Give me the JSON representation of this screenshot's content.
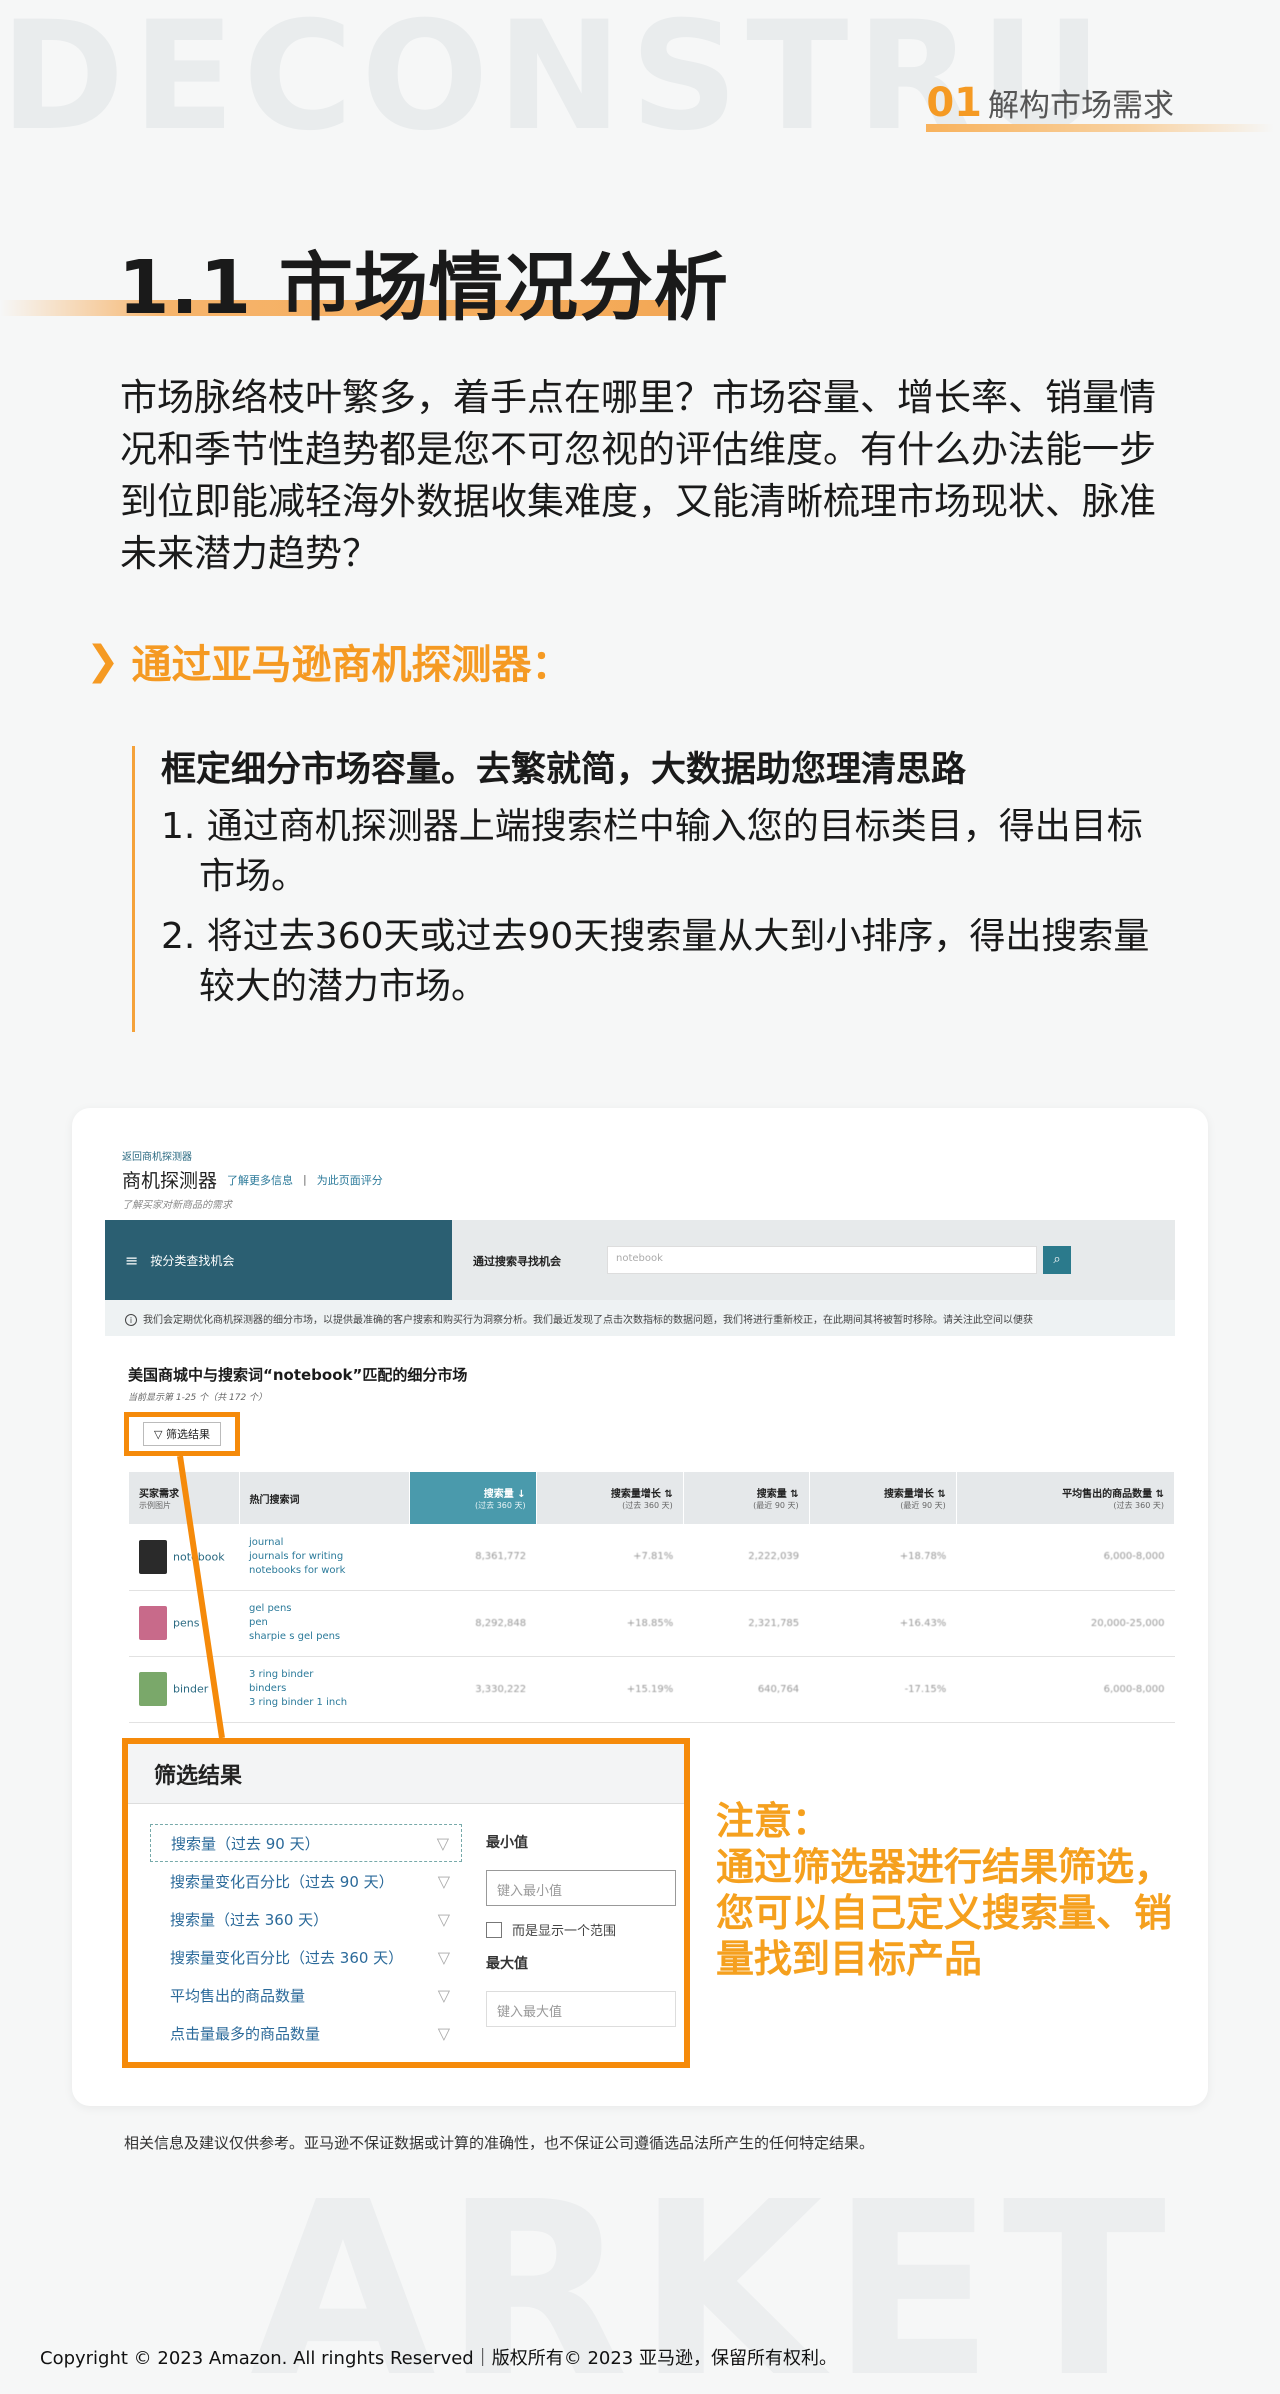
{
  "background": {
    "top_word": "DECONSTRU",
    "bottom_word": "ARKET"
  },
  "section_tag": {
    "number": "01",
    "label": "解构市场需求"
  },
  "heading": "1.1 市场情况分析",
  "intro": "市场脉络枝叶繁多，着手点在哪里？市场容量、增长率、销量情况和季节性趋势都是您不可忽视的评估维度。有什么办法能一步到位即能减轻海外数据收集难度，又能清晰梳理市场现状、脉准未来潜力趋势？",
  "subheading": "通过亚马逊商机探测器：",
  "quote": {
    "title": "框定细分市场容量。去繁就简，大数据助您理清思路",
    "items": [
      "1. 通过商机探测器上端搜索栏中输入您的目标类目，得出目标市场。",
      "2. 将过去360天或过去90天搜索量从大到小排序，得出搜索量较大的潜力市场。"
    ]
  },
  "screenshot": {
    "breadcrumb": "返回商机探测器",
    "title": "商机探测器",
    "learn_more": "了解更多信息",
    "separator": "|",
    "rate": "为此页面评分",
    "desc": "了解买家对新商品的需求",
    "nav_label": "按分类查找机会",
    "search_label": "通过搜索寻找机会",
    "search_value": "notebook",
    "notice": "我们会定期优化商机探测器的细分市场，以提供最准确的客户搜索和购买行为洞察分析。我们最近发现了点击次数指标的数据问题，我们将进行重新校正，在此期间其将被暂时移除。请关注此空间以便获",
    "results_title": "美国商城中与搜索词“notebook”匹配的细分市场",
    "results_count": "当前显示第 1-25 个（共 172 个）",
    "filter_button": "筛选结果",
    "columns": [
      {
        "name": "买家需求",
        "sub": "示例图片"
      },
      {
        "name": "热门搜索词",
        "sub": ""
      },
      {
        "name": "搜索量",
        "sub": "(过去 360 天)"
      },
      {
        "name": "搜索量增长",
        "sub": "(过去 360 天)"
      },
      {
        "name": "搜索量",
        "sub": "(最近 90 天)"
      },
      {
        "name": "搜索量增长",
        "sub": "(最近 90 天)"
      },
      {
        "name": "平均售出的商品数量",
        "sub": "(过去 360 天)"
      }
    ],
    "rows": [
      {
        "niche": "notebook",
        "keywords": [
          "journal",
          "journals for writing",
          "notebooks for work"
        ],
        "v1": "8,361,772",
        "v2": "+7.81%",
        "v3": "2,222,039",
        "v4": "+18.78%",
        "v5": "6,000-8,000",
        "color": "#2a2a2a"
      },
      {
        "niche": "pens",
        "keywords": [
          "gel pens",
          "pen",
          "sharpie s gel pens"
        ],
        "v1": "8,292,848",
        "v2": "+18.85%",
        "v3": "2,321,785",
        "v4": "+16.43%",
        "v5": "20,000-25,000",
        "color": "#c86a8a"
      },
      {
        "niche": "binder",
        "keywords": [
          "3 ring binder",
          "binders",
          "3 ring binder 1 inch"
        ],
        "v1": "3,330,222",
        "v2": "+15.19%",
        "v3": "640,764",
        "v4": "-17.15%",
        "v5": "6,000-8,000",
        "color": "#7aa86a"
      }
    ],
    "filter_panel": {
      "title": "筛选结果",
      "items": [
        "搜索量（过去 90 天）",
        "搜索量变化百分比（过去 90 天）",
        "搜索量（过去 360 天）",
        "搜索量变化百分比（过去 360 天）",
        "平均售出的商品数量",
        "点击量最多的商品数量"
      ],
      "min_label": "最小值",
      "min_placeholder": "键入最小值",
      "range_check": "而是显示一个范围",
      "max_label": "最大值",
      "max_placeholder": "键入最大值"
    }
  },
  "note": {
    "title": "注意：",
    "body": "通过筛选器进行结果筛选，您可以自己定义搜索量、销量找到目标产品"
  },
  "disclaimer": "相关信息及建议仅供参考。亚马逊不保证数据或计算的准确性，也不保证公司遵循选品法所产生的任何特定结果。",
  "copyright": "Copyright © 2023 Amazon. All ringhts Reserved｜版权所有© 2023 亚马逊，保留所有权利。",
  "colors": {
    "accent": "#f58a0a",
    "teal": "#2b5f72",
    "note": "#f5a01e"
  }
}
